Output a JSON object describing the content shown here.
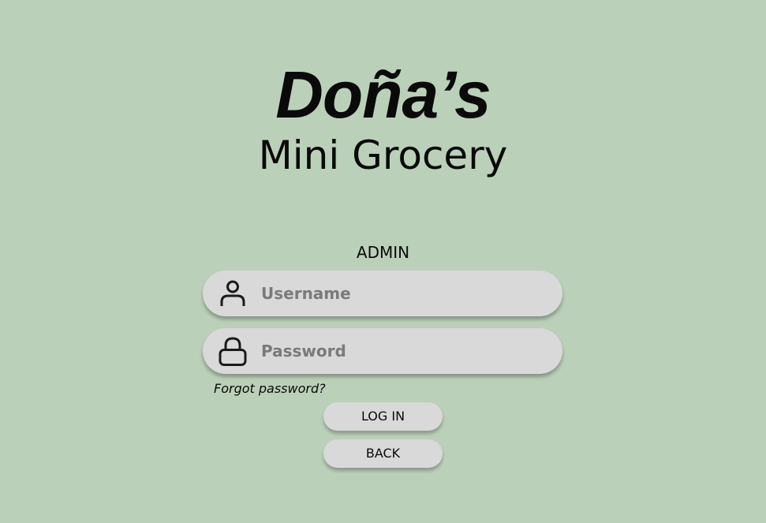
{
  "brand": {
    "title": "Doña’s",
    "subtitle": "Mini Grocery"
  },
  "login_form": {
    "role_label": "ADMIN",
    "username": {
      "placeholder": "Username",
      "value": "",
      "icon": "user-icon"
    },
    "password": {
      "placeholder": "Password",
      "value": "",
      "icon": "lock-icon"
    },
    "forgot_password_label": "Forgot password?",
    "login_button_label": "LOG IN",
    "back_button_label": "BACK"
  },
  "colors": {
    "background": "#bbd0b9",
    "field_background": "#d9d9d9",
    "text": "#0a0a0a",
    "placeholder": "#7a7a7a"
  }
}
